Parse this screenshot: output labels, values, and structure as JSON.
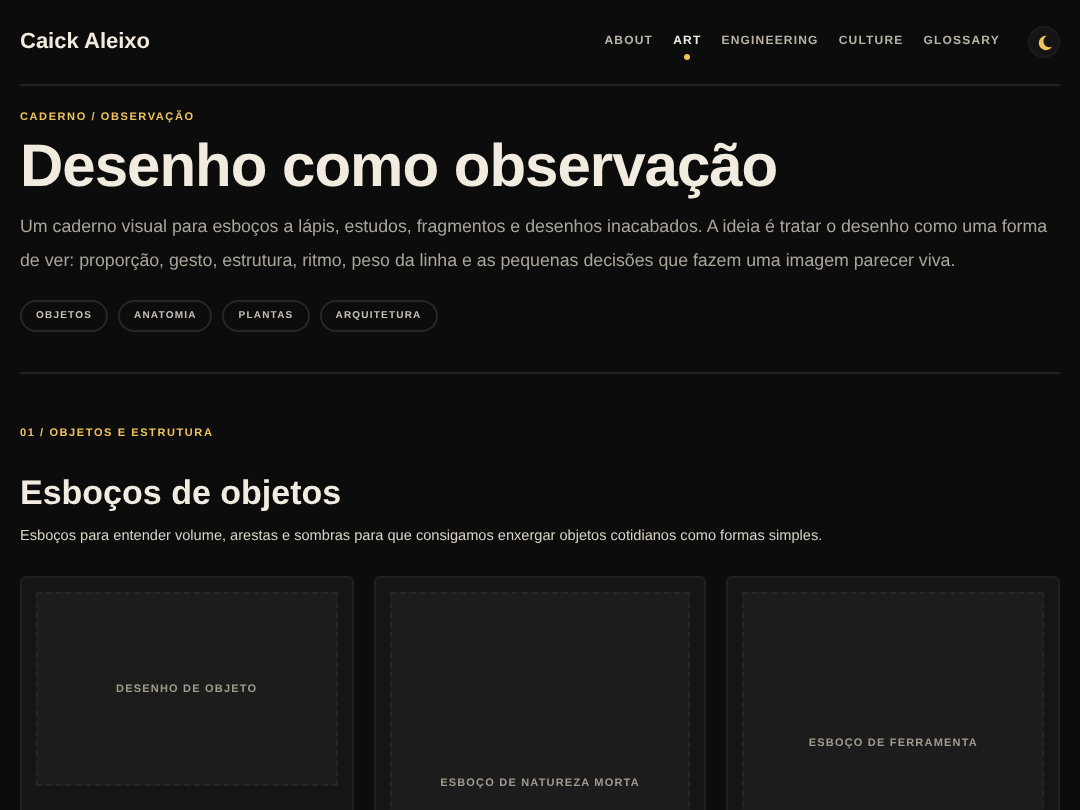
{
  "header": {
    "brand": "Caick Aleixo",
    "nav": [
      {
        "label": "ABOUT",
        "selected": false
      },
      {
        "label": "ART",
        "selected": true
      },
      {
        "label": "ENGINEERING",
        "selected": false
      },
      {
        "label": "CULTURE",
        "selected": false
      },
      {
        "label": "GLOSSARY",
        "selected": false
      }
    ]
  },
  "hero": {
    "eyebrow": "CADERNO / OBSERVAÇÃO",
    "title": "Desenho como observação",
    "description": "Um caderno visual para esboços a lápis, estudos, fragmentos e desenhos inacabados. A ideia é tratar o desenho como uma forma de ver: proporção, gesto, estrutura, ritmo, peso da linha e as pequenas decisões que fazem uma imagem parecer viva.",
    "tags": [
      "OBJETOS",
      "ANATOMIA",
      "PLANTAS",
      "ARQUITETURA"
    ]
  },
  "section": {
    "eyebrow": "01 / OBJETOS E ESTRUTURA",
    "title": "Esboços de objetos",
    "description": "Esboços para entender volume, arestas e sombras para que consigamos enxergar objetos cotidianos como formas simples.",
    "cards": [
      {
        "placeholder": "DESENHO DE OBJETO"
      },
      {
        "placeholder": "ESBOÇO DE NATUREZA MORTA"
      },
      {
        "placeholder": "ESBOÇO DE FERRAMENTA"
      }
    ]
  }
}
